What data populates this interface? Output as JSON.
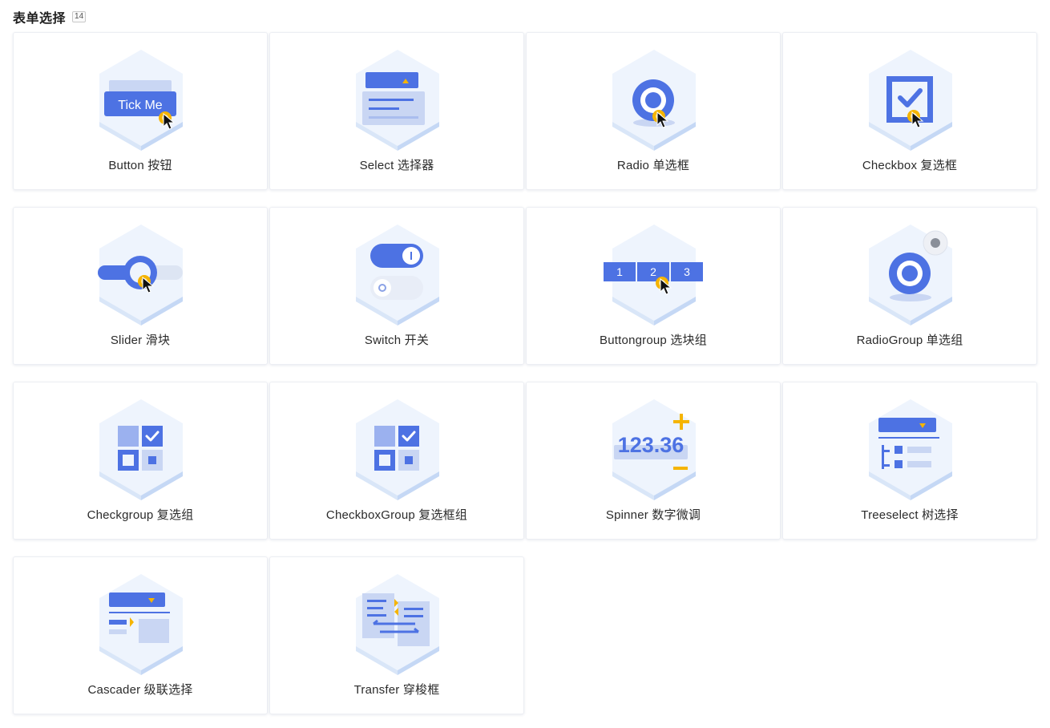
{
  "section": {
    "title": "表单选择",
    "count": "14"
  },
  "cards": [
    {
      "label": "Button 按钮",
      "icon": "button-icon"
    },
    {
      "label": "Select 选择器",
      "icon": "select-icon"
    },
    {
      "label": "Radio 单选框",
      "icon": "radio-icon"
    },
    {
      "label": "Checkbox 复选框",
      "icon": "checkbox-icon"
    },
    {
      "label": "Slider 滑块",
      "icon": "slider-icon"
    },
    {
      "label": "Switch 开关",
      "icon": "switch-icon"
    },
    {
      "label": "Buttongroup 选块组",
      "icon": "buttongroup-icon"
    },
    {
      "label": "RadioGroup 单选组",
      "icon": "radiogroup-icon"
    },
    {
      "label": "Checkgroup 复选组",
      "icon": "checkgroup-icon"
    },
    {
      "label": "CheckboxGroup 复选框组",
      "icon": "checkboxgroup-icon"
    },
    {
      "label": "Spinner 数字微调",
      "icon": "spinner-icon"
    },
    {
      "label": "Treeselect 树选择",
      "icon": "treeselect-icon"
    },
    {
      "label": "Cascader 级联选择",
      "icon": "cascader-icon"
    },
    {
      "label": "Transfer 穿梭框",
      "icon": "transfer-icon"
    }
  ],
  "icon_text": {
    "button_caption": "Tick Me",
    "buttongroup": [
      "1",
      "2",
      "3"
    ],
    "spinner_value": "123.36"
  },
  "colors": {
    "primary": "#4d72e3",
    "accent": "#f5b400",
    "hex_light": "#eef4fd"
  }
}
